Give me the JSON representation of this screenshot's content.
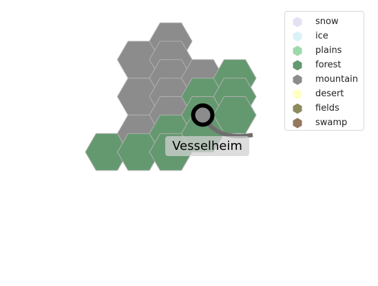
{
  "map": {
    "terrain_colors": {
      "snow": "#e6e0f3",
      "ice": "#dcf2f8",
      "plains": "#9ed9ac",
      "forest": "#64996f",
      "mountain": "#8c8c8c",
      "desert": "#ffffc4",
      "fields": "#8b8b5e",
      "swamp": "#94785e"
    },
    "tiles": [
      {
        "col": 0,
        "row": 0,
        "terrain": "mountain"
      },
      {
        "col": -1,
        "row": 1,
        "terrain": "mountain"
      },
      {
        "col": 0,
        "row": 1,
        "terrain": "mountain"
      },
      {
        "col": 0,
        "row": 2,
        "terrain": "mountain"
      },
      {
        "col": 1,
        "row": 2,
        "terrain": "mountain"
      },
      {
        "col": 2,
        "row": 2,
        "terrain": "forest"
      },
      {
        "col": -1,
        "row": 3,
        "terrain": "mountain"
      },
      {
        "col": 0,
        "row": 3,
        "terrain": "mountain"
      },
      {
        "col": 1,
        "row": 3,
        "terrain": "forest"
      },
      {
        "col": 2,
        "row": 3,
        "terrain": "forest"
      },
      {
        "col": 0,
        "row": 4,
        "terrain": "mountain"
      },
      {
        "col": 1,
        "row": 4,
        "terrain": "forest"
      },
      {
        "col": 2,
        "row": 4,
        "terrain": "forest"
      },
      {
        "col": -1,
        "row": 5,
        "terrain": "mountain"
      },
      {
        "col": 0,
        "row": 5,
        "terrain": "forest"
      },
      {
        "col": 1,
        "row": 5,
        "terrain": "forest"
      },
      {
        "col": -2,
        "row": 6,
        "terrain": "forest"
      },
      {
        "col": -1,
        "row": 6,
        "terrain": "forest"
      },
      {
        "col": 0,
        "row": 6,
        "terrain": "forest"
      }
    ],
    "settlement": {
      "name": "Vesselheim",
      "col": 1,
      "row": 4
    },
    "river": {
      "from": {
        "col": 1,
        "row": 4
      },
      "to": {
        "col": 2,
        "row": 5
      },
      "color": "#6e6e6e"
    }
  },
  "legend": {
    "items": [
      {
        "label": "snow",
        "color": "#e6e0f3"
      },
      {
        "label": "ice",
        "color": "#dcf2f8"
      },
      {
        "label": "plains",
        "color": "#9ed9ac"
      },
      {
        "label": "forest",
        "color": "#64996f"
      },
      {
        "label": "mountain",
        "color": "#8c8c8c"
      },
      {
        "label": "desert",
        "color": "#ffffc4"
      },
      {
        "label": "fields",
        "color": "#8b8b5e"
      },
      {
        "label": "swamp",
        "color": "#94785e"
      }
    ]
  }
}
